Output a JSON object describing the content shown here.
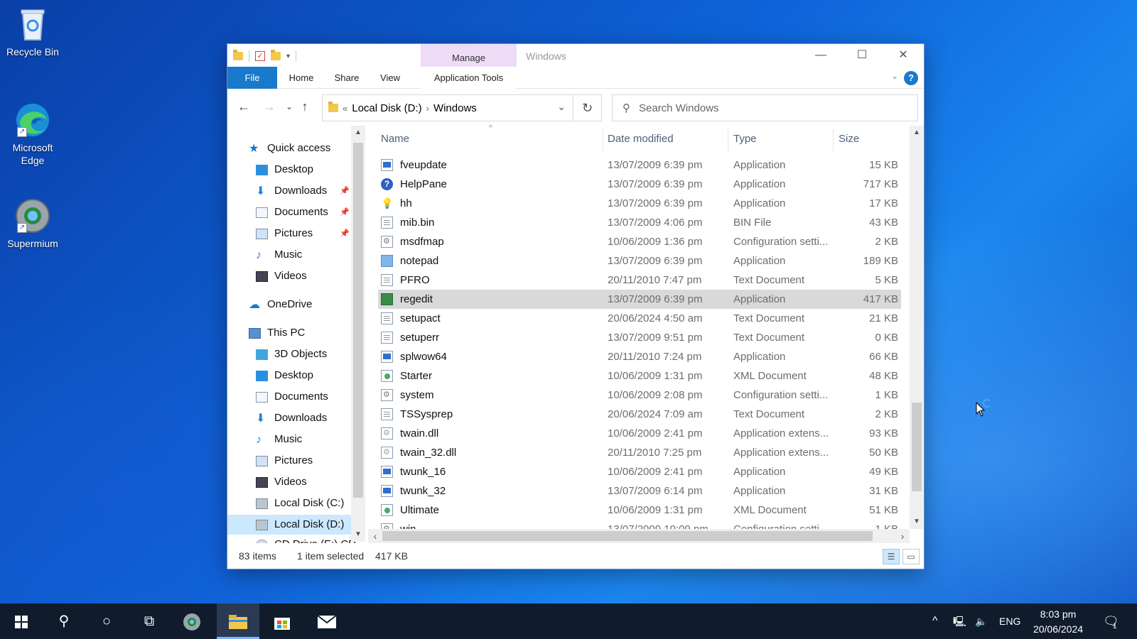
{
  "desktop": {
    "icons": [
      {
        "label": "Recycle Bin",
        "icon": "recycle-bin-icon"
      },
      {
        "label": "Microsoft Edge",
        "icon": "edge-icon"
      },
      {
        "label": "Supermium",
        "icon": "supermium-icon"
      }
    ]
  },
  "window": {
    "title": "Windows",
    "context_tab": "Manage",
    "ribbon_tabs": [
      "File",
      "Home",
      "Share",
      "View",
      "Application Tools"
    ],
    "help": "?"
  },
  "address": {
    "overflow": "«",
    "crumbs": [
      "Local Disk (D:)",
      "Windows"
    ],
    "search_placeholder": "Search Windows"
  },
  "nav": {
    "quick_access": "Quick access",
    "quick_items": [
      "Desktop",
      "Downloads",
      "Documents",
      "Pictures",
      "Music",
      "Videos"
    ],
    "onedrive": "OneDrive",
    "this_pc": "This PC",
    "pc_items": [
      "3D Objects",
      "Desktop",
      "Documents",
      "Downloads",
      "Music",
      "Pictures",
      "Videos",
      "Local Disk (C:)",
      "Local Disk (D:)",
      "CD Drive (E:) CD"
    ]
  },
  "columns": {
    "name": "Name",
    "date": "Date modified",
    "type": "Type",
    "size": "Size"
  },
  "files": [
    {
      "name": "fveupdate",
      "date": "13/07/2009 6:39 pm",
      "type": "Application",
      "size": "15 KB",
      "icon": "app"
    },
    {
      "name": "HelpPane",
      "date": "13/07/2009 6:39 pm",
      "type": "Application",
      "size": "717 KB",
      "icon": "help"
    },
    {
      "name": "hh",
      "date": "13/07/2009 6:39 pm",
      "type": "Application",
      "size": "17 KB",
      "icon": "hh"
    },
    {
      "name": "mib.bin",
      "date": "13/07/2009 4:06 pm",
      "type": "BIN File",
      "size": "43 KB",
      "icon": "doc"
    },
    {
      "name": "msdfmap",
      "date": "10/06/2009 1:36 pm",
      "type": "Configuration setti...",
      "size": "2 KB",
      "icon": "cfg"
    },
    {
      "name": "notepad",
      "date": "13/07/2009 6:39 pm",
      "type": "Application",
      "size": "189 KB",
      "icon": "note"
    },
    {
      "name": "PFRO",
      "date": "20/11/2010 7:47 pm",
      "type": "Text Document",
      "size": "5 KB",
      "icon": "doc"
    },
    {
      "name": "regedit",
      "date": "13/07/2009 6:39 pm",
      "type": "Application",
      "size": "417 KB",
      "icon": "reg",
      "selected": true
    },
    {
      "name": "setupact",
      "date": "20/06/2024 4:50 am",
      "type": "Text Document",
      "size": "21 KB",
      "icon": "doc"
    },
    {
      "name": "setuperr",
      "date": "13/07/2009 9:51 pm",
      "type": "Text Document",
      "size": "0 KB",
      "icon": "doc"
    },
    {
      "name": "splwow64",
      "date": "20/11/2010 7:24 pm",
      "type": "Application",
      "size": "66 KB",
      "icon": "app"
    },
    {
      "name": "Starter",
      "date": "10/06/2009 1:31 pm",
      "type": "XML Document",
      "size": "48 KB",
      "icon": "xml"
    },
    {
      "name": "system",
      "date": "10/06/2009 2:08 pm",
      "type": "Configuration setti...",
      "size": "1 KB",
      "icon": "cfg"
    },
    {
      "name": "TSSysprep",
      "date": "20/06/2024 7:09 am",
      "type": "Text Document",
      "size": "2 KB",
      "icon": "doc"
    },
    {
      "name": "twain.dll",
      "date": "10/06/2009 2:41 pm",
      "type": "Application extens...",
      "size": "93 KB",
      "icon": "dll"
    },
    {
      "name": "twain_32.dll",
      "date": "20/11/2010 7:25 pm",
      "type": "Application extens...",
      "size": "50 KB",
      "icon": "dll"
    },
    {
      "name": "twunk_16",
      "date": "10/06/2009 2:41 pm",
      "type": "Application",
      "size": "49 KB",
      "icon": "app"
    },
    {
      "name": "twunk_32",
      "date": "13/07/2009 6:14 pm",
      "type": "Application",
      "size": "31 KB",
      "icon": "app"
    },
    {
      "name": "Ultimate",
      "date": "10/06/2009 1:31 pm",
      "type": "XML Document",
      "size": "51 KB",
      "icon": "xml"
    },
    {
      "name": "win",
      "date": "13/07/2009 10:09 pm",
      "type": "Configuration setti...",
      "size": "1 KB",
      "icon": "cfg"
    }
  ],
  "status": {
    "count": "83 items",
    "selected": "1 item selected",
    "size": "417 KB"
  },
  "taskbar": {
    "lang": "ENG",
    "time": "8:03 pm",
    "date": "20/06/2024",
    "notification_count": "1"
  },
  "colors": {
    "accent": "#1979ca",
    "manage_bg": "#eedcf7",
    "selection": "#d9d9d9",
    "nav_selection": "#cce8ff"
  }
}
